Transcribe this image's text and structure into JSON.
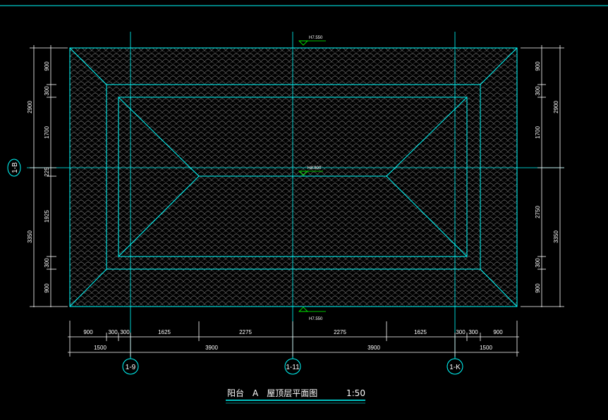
{
  "colors": {
    "background": "#000000",
    "cyan": "#00ffff",
    "white": "#ffffff",
    "green": "#00ff00",
    "tile": "#8a8a8a"
  },
  "elevations": {
    "top": "H7.550",
    "center": "H8.800",
    "bottom": "H7.550"
  },
  "left_dims": {
    "outer": [
      "2900",
      "3350"
    ],
    "inner": [
      "900",
      "300",
      "1700",
      "225",
      "1925",
      "300",
      "900"
    ]
  },
  "right_dims": {
    "outer": [
      "2900",
      "3350"
    ],
    "inner": [
      "900",
      "300",
      "1700",
      "2750",
      "300",
      "900"
    ]
  },
  "bottom_dims": {
    "row1": [
      "900",
      "300",
      "300",
      "1625",
      "2275",
      "2275",
      "1625",
      "300",
      "300",
      "900"
    ],
    "row2": [
      "1500",
      "3900",
      "3900",
      "1500"
    ]
  },
  "axes": {
    "left": "1-B",
    "bottom": [
      "1-9",
      "1-11",
      "1-K"
    ]
  },
  "title": {
    "main": "阳台　A　屋顶层平面图",
    "scale": "1:50"
  }
}
